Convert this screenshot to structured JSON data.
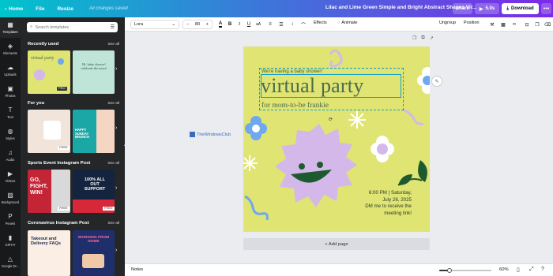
{
  "topbar": {
    "home": "Home",
    "file": "File",
    "resize": "Resize",
    "saved": "All changes saved",
    "doc_title": "Lilac and Lime Green Simple and Bright Abstract Shapes Vir...",
    "share": "Share",
    "play_time": "5.0s",
    "download": "Download",
    "more": "•••"
  },
  "rail": [
    {
      "label": "Templates",
      "icon": "templates-icon",
      "glyph": "▦"
    },
    {
      "label": "Elements",
      "icon": "elements-icon",
      "glyph": "◈"
    },
    {
      "label": "Uploads",
      "icon": "uploads-icon",
      "glyph": "☁"
    },
    {
      "label": "Photos",
      "icon": "photos-icon",
      "glyph": "▣"
    },
    {
      "label": "Text",
      "icon": "text-icon",
      "glyph": "T"
    },
    {
      "label": "Styles",
      "icon": "styles-icon",
      "glyph": "◍"
    },
    {
      "label": "Audio",
      "icon": "audio-icon",
      "glyph": "♫"
    },
    {
      "label": "Videos",
      "icon": "videos-icon",
      "glyph": "▶"
    },
    {
      "label": "Background",
      "icon": "background-icon",
      "glyph": "▨"
    },
    {
      "label": "Pexels",
      "icon": "pexels-icon",
      "glyph": "P"
    },
    {
      "label": "GIPHY",
      "icon": "giphy-icon",
      "glyph": "▮"
    },
    {
      "label": "Google Dr...",
      "icon": "google-drive-icon",
      "glyph": "△"
    }
  ],
  "panel": {
    "search_placeholder": "Search templates",
    "see_all": "See all",
    "sections": [
      {
        "title": "Recently used"
      },
      {
        "title": "For you"
      },
      {
        "title": "Sports Event Instagram Post"
      },
      {
        "title": "Coronavirus Instagram Post"
      }
    ],
    "thumbs": {
      "t1": "virtual party",
      "t2": "Hi, baby shower! celebrate the news!",
      "t3": "HAPPY SUNDAY BRUNCH",
      "t4a": "GO, FIGHT, WIN!",
      "t4b": "100% ALL OUT SUPPORT",
      "t5a": "Takeout and Delivery FAQs",
      "t5b": "WORKING FROM HOME",
      "pro": "PRO",
      "free": "FREE"
    }
  },
  "toolbar": {
    "font": "Lora",
    "size": "80",
    "effects": "Effects",
    "animate": "Animate",
    "ungroup": "Ungroup",
    "position": "Position"
  },
  "page": {
    "baby": "We're having a baby shower!",
    "title": "virtual party",
    "sub": "for mom-to-be frankie",
    "details": [
      "6:00 PM | Saturday,",
      "July 26, 2025",
      "DM me to receive the",
      "meeting link!"
    ]
  },
  "workspace": {
    "add_page": "+ Add page",
    "watermark": "TheWindowsClub"
  },
  "bottombar": {
    "notes": "Notes",
    "zoom": "60%",
    "zoom_level": 0.6
  },
  "colors": {
    "page_bg": "#dfe473",
    "lilac": "#d4b8ea",
    "blue": "#6fa8f0",
    "green": "#2f6b35"
  }
}
